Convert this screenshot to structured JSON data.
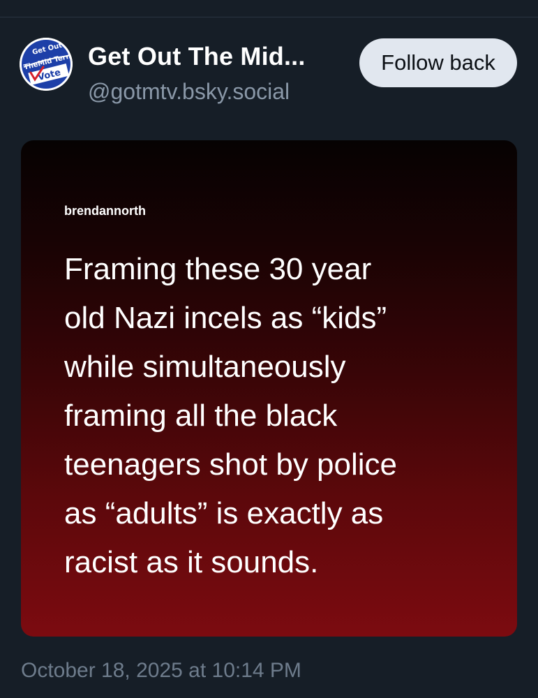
{
  "post": {
    "author": {
      "display_name": "Get Out The Mid...",
      "handle": "@gotmtv.bsky.social",
      "avatar_text": [
        "Get Out",
        "TheMid Tern",
        "Vote"
      ]
    },
    "follow_button_label": "Follow back",
    "image": {
      "username": "brendannorth",
      "text_lines": [
        "Framing these 30 year",
        "old Nazi incels as “kids”",
        "while simultaneously",
        "framing all the black",
        "teenagers shot by police",
        "as “adults” is exactly as",
        "racist as it sounds."
      ]
    },
    "timestamp": "October 18, 2025 at 10:14 PM"
  },
  "colors": {
    "background": "#161e27",
    "button_bg": "#e1e7ef",
    "handle_text": "#8a98a8",
    "card_gradient_top": "#060202",
    "card_gradient_bottom": "#7c0b10",
    "avatar_blue": "#1d3fa8",
    "avatar_red": "#d6202a"
  }
}
